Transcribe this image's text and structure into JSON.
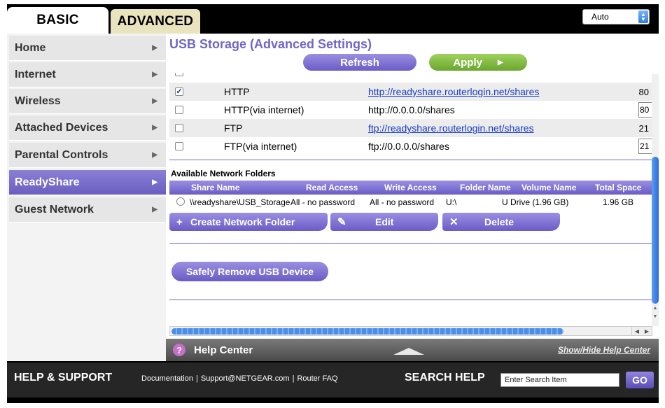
{
  "tabs": {
    "basic": "BASIC",
    "advanced": "ADVANCED"
  },
  "language": {
    "selected": "Auto"
  },
  "nav": {
    "items": [
      {
        "label": "Home"
      },
      {
        "label": "Internet"
      },
      {
        "label": "Wireless"
      },
      {
        "label": "Attached Devices"
      },
      {
        "label": "Parental Controls"
      },
      {
        "label": "ReadyShare",
        "active": true
      },
      {
        "label": "Guest Network"
      }
    ]
  },
  "page": {
    "title": "USB Storage (Advanced Settings)",
    "refresh_label": "Refresh",
    "apply_label": "Apply"
  },
  "access_rows": [
    {
      "checked": true,
      "name": "HTTP",
      "address": "http://readyshare.routerlogin.net/shares",
      "is_link": true,
      "port": "80",
      "editable_port": false
    },
    {
      "checked": false,
      "name": "HTTP(via internet)",
      "address": "http://0.0.0.0/shares",
      "is_link": false,
      "port": "80",
      "editable_port": true
    },
    {
      "checked": false,
      "name": "FTP",
      "address": "ftp://readyshare.routerlogin.net/shares",
      "is_link": true,
      "port": "21",
      "editable_port": false
    },
    {
      "checked": false,
      "name": "FTP(via internet)",
      "address": "ftp://0.0.0.0/shares",
      "is_link": false,
      "port": "21",
      "editable_port": true
    }
  ],
  "folders": {
    "section_label": "Available Network Folders",
    "columns": [
      "Share Name",
      "Read Access",
      "Write Access",
      "Folder Name",
      "Volume Name",
      "Total Space"
    ],
    "rows": [
      {
        "share_name": "\\\\readyshare\\USB_Storage",
        "read_access": "All - no password",
        "write_access": "All - no password",
        "folder_name": "U:\\",
        "volume_name": "U Drive (1.96 GB)",
        "total_space": "1.96 GB"
      }
    ],
    "create_label": "Create Network Folder",
    "edit_label": "Edit",
    "delete_label": "Delete"
  },
  "safely_remove_label": "Safely Remove USB Device",
  "help": {
    "title": "Help Center",
    "toggle_label": "Show/Hide Help Center"
  },
  "support": {
    "title": "HELP & SUPPORT",
    "links": [
      "Documentation",
      "Support@NETGEAR.com",
      "Router FAQ"
    ],
    "search_title": "SEARCH HELP",
    "search_placeholder": "Enter Search Item",
    "go_label": "GO"
  },
  "colors": {
    "accent_purple": "#6f66c8",
    "apply_green": "#7cb83e",
    "link_blue": "#1a3bc9"
  }
}
